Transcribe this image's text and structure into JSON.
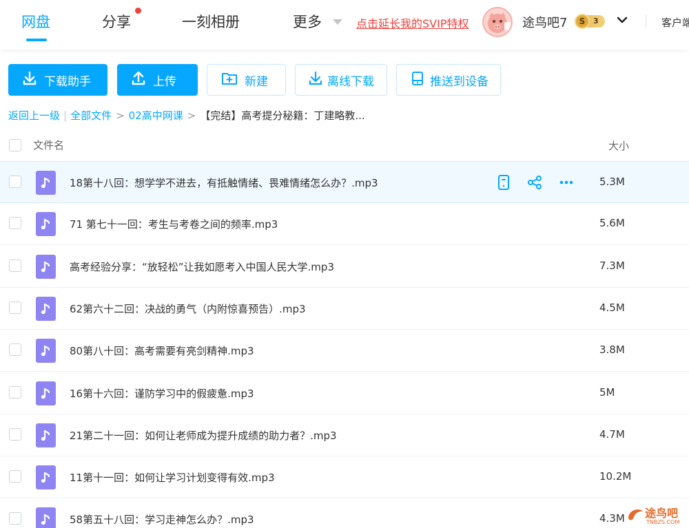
{
  "nav": {
    "items": [
      "网盘",
      "分享",
      "一刻相册",
      "更多"
    ],
    "active_index": 0,
    "share_has_notification": true,
    "svip_link": "点击延长我的SVIP特权",
    "username": "途鸟吧7",
    "vip_level": "3",
    "vip_symbol": "S",
    "client_label": "客户端"
  },
  "toolbar": {
    "download_helper": "下载助手",
    "upload": "上传",
    "new": "新建",
    "offline_download": "离线下载",
    "push_to_device": "推送到设备"
  },
  "breadcrumb": {
    "back": "返回上一级",
    "all_files": "全部文件",
    "folder": "02高中网课",
    "current": "【完结】高考提分秘籍：丁建略教..."
  },
  "list": {
    "header_name": "文件名",
    "header_size": "大小",
    "files": [
      {
        "name": "18第十八回：想学学不进去，有抵触情绪、畏难情绪怎么办？.mp3",
        "size": "5.3M"
      },
      {
        "name": "71 第七十一回：考生与考卷之间的频率.mp3",
        "size": "5.6M"
      },
      {
        "name": "高考经验分享：“放轻松”让我如愿考入中国人民大学.mp3",
        "size": "7.3M"
      },
      {
        "name": "62第六十二回：决战的勇气（内附惊喜预告）.mp3",
        "size": "4.5M"
      },
      {
        "name": "80第八十回：高考需要有亮剑精神.mp3",
        "size": "3.8M"
      },
      {
        "name": "16第十六回：谨防学习中的假疲惫.mp3",
        "size": "5M"
      },
      {
        "name": "21第二十一回：如何让老师成为提升成绩的助力者？.mp3",
        "size": "4.7M"
      },
      {
        "name": "11第十一回：如何让学习计划变得有效.mp3",
        "size": "10.2M"
      },
      {
        "name": "58第五十八回：学习走神怎么办？.mp3",
        "size": "4.3M"
      }
    ]
  },
  "watermark": {
    "text": "途鸟吧",
    "sub": "TNBZS.COM"
  },
  "colors": {
    "accent": "#06a7ff",
    "file_icon": "#8e85f2",
    "svip_red": "#f0413b"
  }
}
